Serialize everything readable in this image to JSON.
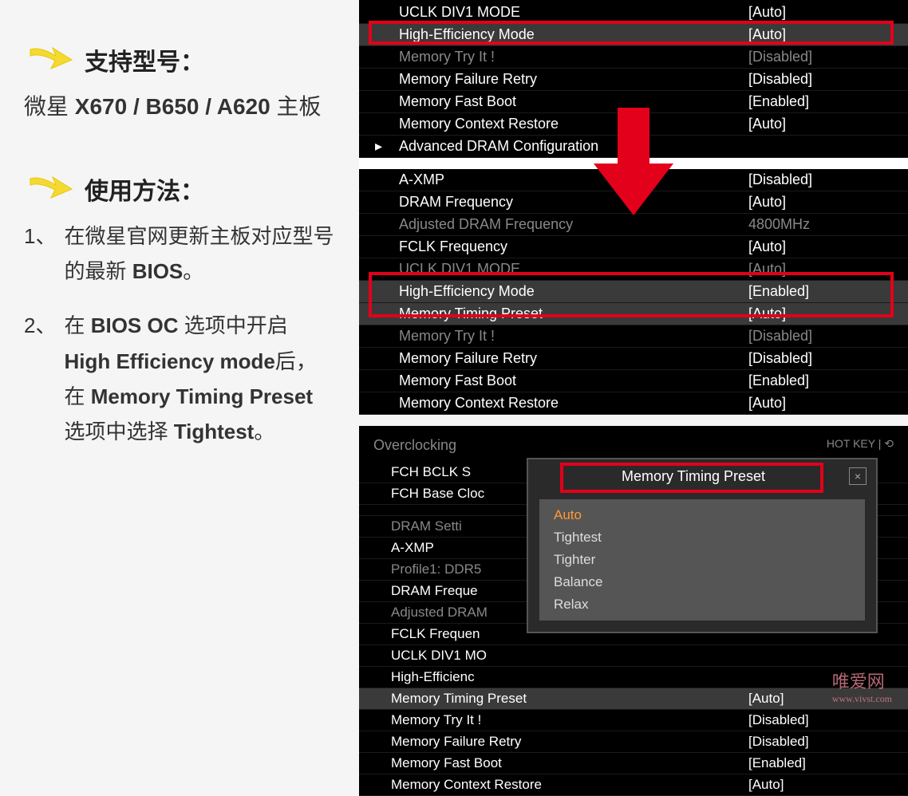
{
  "left": {
    "supported_heading": "支持型号：",
    "models_prefix": "微星",
    "models_bold": "X670 / B650 / A620",
    "models_suffix": "主板",
    "usage_heading": "使用方法：",
    "steps": [
      {
        "num": "1、",
        "parts": [
          "在微星官网更新主板对应型号的最新 ",
          "BIOS",
          "。"
        ]
      },
      {
        "num": "2、",
        "parts": [
          "在 ",
          "BIOS OC",
          " 选项中开启 ",
          "High Efficiency mode",
          "后，在 ",
          "Memory Timing Preset",
          " 选项中选择 ",
          "Tightest",
          "。"
        ]
      }
    ]
  },
  "bios_top": {
    "rows": [
      {
        "label": "UCLK DIV1 MODE",
        "val": "[Auto]",
        "hl": false
      },
      {
        "label": "High-Efficiency Mode",
        "val": "[Auto]",
        "hl": true
      },
      {
        "label": "Memory Try It !",
        "val": "[Disabled]",
        "hl": false,
        "dim": true
      },
      {
        "label": "Memory Failure Retry",
        "val": "[Disabled]",
        "hl": false
      },
      {
        "label": "Memory Fast Boot",
        "val": "[Enabled]",
        "hl": false
      },
      {
        "label": "Memory Context Restore",
        "val": "[Auto]",
        "hl": false
      },
      {
        "label": "Advanced DRAM Configuration",
        "val": "",
        "hl": false,
        "caret": true
      }
    ],
    "rows2": [
      {
        "label": "A-XMP",
        "val": "[Disabled]",
        "hl": false
      },
      {
        "label": "DRAM Frequency",
        "val": "[Auto]",
        "hl": false
      },
      {
        "label": "Adjusted DRAM Frequency",
        "val": "4800MHz",
        "hl": false,
        "dim": true
      },
      {
        "label": "FCLK Frequency",
        "val": "[Auto]",
        "hl": false
      },
      {
        "label": "UCLK DIV1 MODE",
        "val": "[Auto]",
        "hl": false,
        "dim": true
      },
      {
        "label": "High-Efficiency Mode",
        "val": "[Enabled]",
        "hl": true
      },
      {
        "label": "Memory Timing Preset",
        "val": "[Auto]",
        "hl": true
      },
      {
        "label": "Memory Try It !",
        "val": "[Disabled]",
        "hl": false,
        "dim": true
      },
      {
        "label": "Memory Failure Retry",
        "val": "[Disabled]",
        "hl": false
      },
      {
        "label": "Memory Fast Boot",
        "val": "[Enabled]",
        "hl": false
      },
      {
        "label": "Memory Context Restore",
        "val": "[Auto]",
        "hl": false
      }
    ]
  },
  "bios_oc": {
    "title": "Overclocking",
    "hotkey": "HOT KEY  |  ⟲",
    "rows": [
      {
        "label": "FCH BCLK S",
        "val": ""
      },
      {
        "label": "FCH Base Cloc",
        "val": ""
      },
      {
        "label": "",
        "val": "",
        "blank": true
      },
      {
        "label": "DRAM Setti",
        "val": "",
        "dim": true
      },
      {
        "label": "A-XMP",
        "val": ""
      },
      {
        "label": "Profile1: DDR5",
        "val": "",
        "dim": true
      },
      {
        "label": "DRAM Freque",
        "val": ""
      },
      {
        "label": "Adjusted DRAM",
        "val": "",
        "dim": true
      },
      {
        "label": "FCLK Frequen",
        "val": ""
      },
      {
        "label": "UCLK DIV1 MO",
        "val": ""
      },
      {
        "label": "High-Efficienc",
        "val": ""
      },
      {
        "label": "Memory Timing Preset",
        "val": "[Auto]",
        "hl": true
      },
      {
        "label": "Memory Try It !",
        "val": "[Disabled]"
      },
      {
        "label": "Memory Failure Retry",
        "val": "[Disabled]"
      },
      {
        "label": "Memory Fast Boot",
        "val": "[Enabled]"
      },
      {
        "label": "Memory Context Restore",
        "val": "[Auto]"
      }
    ],
    "popup": {
      "title": "Memory Timing Preset",
      "items": [
        "Auto",
        "Tightest",
        "Tighter",
        "Balance",
        "Relax"
      ],
      "selected": 0
    }
  },
  "watermark": {
    "main": "唯爱网",
    "sub": "www.vivst.com"
  }
}
